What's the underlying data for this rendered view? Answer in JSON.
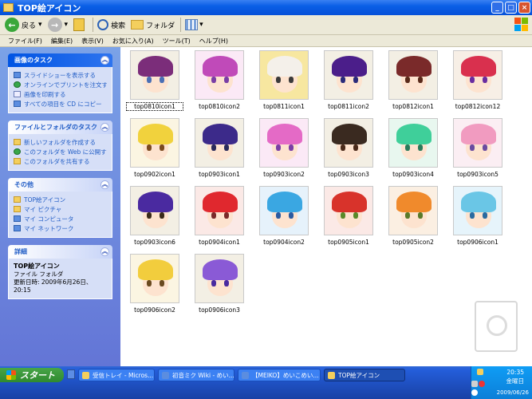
{
  "window": {
    "title": "TOP絵アイコン"
  },
  "toolbar": {
    "back_label": "戻る",
    "search_label": "検索",
    "folders_label": "フォルダ"
  },
  "menu": [
    "ファイル(F)",
    "編集(E)",
    "表示(V)",
    "お気に入り(A)",
    "ツール(T)",
    "ヘルプ(H)"
  ],
  "sidebar": {
    "image_tasks": {
      "title": "画像のタスク",
      "items": [
        "スライドショーを表示する",
        "オンラインでプリントを注文する",
        "画像を印刷する",
        "すべての項目を CD にコピー"
      ]
    },
    "file_tasks": {
      "title": "ファイルとフォルダのタスク",
      "items": [
        "新しいフォルダを作成する",
        "このフォルダを Web に公開する",
        "このフォルダを共有する"
      ]
    },
    "other_places": {
      "title": "その他",
      "items": [
        "TOP絵アイコン",
        "マイ ピクチャ",
        "マイ コンピュータ",
        "マイ ネットワーク"
      ]
    },
    "details": {
      "title": "詳細",
      "name": "TOP絵アイコン",
      "type": "ファイル フォルダ",
      "modified": "更新日時: 2009年6月26日、20:15"
    }
  },
  "files": [
    {
      "name": "top0810icon1",
      "bg": "#f3efe4",
      "hair": "#7b2d7a",
      "eye": "#4a6fb5"
    },
    {
      "name": "top0810icon2",
      "bg": "#fbe9f6",
      "hair": "#c04ab9",
      "eye": "#7a3ea5"
    },
    {
      "name": "top0811icon1",
      "bg": "#f7e7a0",
      "hair": "#f4f0ea",
      "eye": "#3a3a3a"
    },
    {
      "name": "top0811icon2",
      "bg": "#f3efe4",
      "hair": "#4b1e8a",
      "eye": "#2b2b7a"
    },
    {
      "name": "top0812icon1",
      "bg": "#f3efe4",
      "hair": "#7a2a2a",
      "eye": "#5a2a1a"
    },
    {
      "name": "top0812icon12",
      "bg": "#f7efe6",
      "hair": "#d9304e",
      "eye": "#6a2ca0"
    },
    {
      "name": "top0902icon1",
      "bg": "#fbf5e2",
      "hair": "#f1d23d",
      "eye": "#7a4a20"
    },
    {
      "name": "top0903icon1",
      "bg": "#f3efe4",
      "hair": "#3c2a8a",
      "eye": "#2a2a5a"
    },
    {
      "name": "top0903icon2",
      "bg": "#fbe9f6",
      "hair": "#e46ac6",
      "eye": "#7a3ea5"
    },
    {
      "name": "top0903icon3",
      "bg": "#f3efe4",
      "hair": "#3a2a20",
      "eye": "#4a2a1a"
    },
    {
      "name": "top0903icon4",
      "bg": "#e8f7ef",
      "hair": "#3fcf9a",
      "eye": "#2a7a5a"
    },
    {
      "name": "top0903icon5",
      "bg": "#fbeef3",
      "hair": "#f19bc0",
      "eye": "#6a4aa0"
    },
    {
      "name": "top0903icon6",
      "bg": "#f3efe4",
      "hair": "#4a2aa0",
      "eye": "#3a2a1a"
    },
    {
      "name": "top0904icon1",
      "bg": "#fbe9e6",
      "hair": "#e0282e",
      "eye": "#7a2a2a"
    },
    {
      "name": "top0904icon2",
      "bg": "#e6f2fb",
      "hair": "#3aa7e2",
      "eye": "#2a5aa0"
    },
    {
      "name": "top0905icon1",
      "bg": "#fbe9e6",
      "hair": "#d8332b",
      "eye": "#5a8a2a"
    },
    {
      "name": "top0905icon2",
      "bg": "#fbefe2",
      "hair": "#f08a2c",
      "eye": "#5a7a2a"
    },
    {
      "name": "top0906icon1",
      "bg": "#e6f4fb",
      "hair": "#6ac6e6",
      "eye": "#2a6aa0"
    },
    {
      "name": "top0906icon2",
      "bg": "#fbf5e2",
      "hair": "#f2cd3d",
      "eye": "#6a4a20"
    },
    {
      "name": "top0906icon3",
      "bg": "#f3efe4",
      "hair": "#8a5ad6",
      "eye": "#4a2aa0"
    }
  ],
  "taskbar": {
    "start_label": "スタート",
    "buttons": [
      "受信トレイ - Micros...",
      "初音ミク Wiki - めい...",
      "【MEIKO】めいこめい...",
      "TOP絵アイコン"
    ],
    "time": "20:35",
    "day": "金曜日",
    "date": "2009/06/26"
  },
  "colors": {
    "titlebar": "#0a5fe6",
    "sidebar": "#7ba2e7",
    "taskbar": "#245edb",
    "start": "#47a447"
  }
}
